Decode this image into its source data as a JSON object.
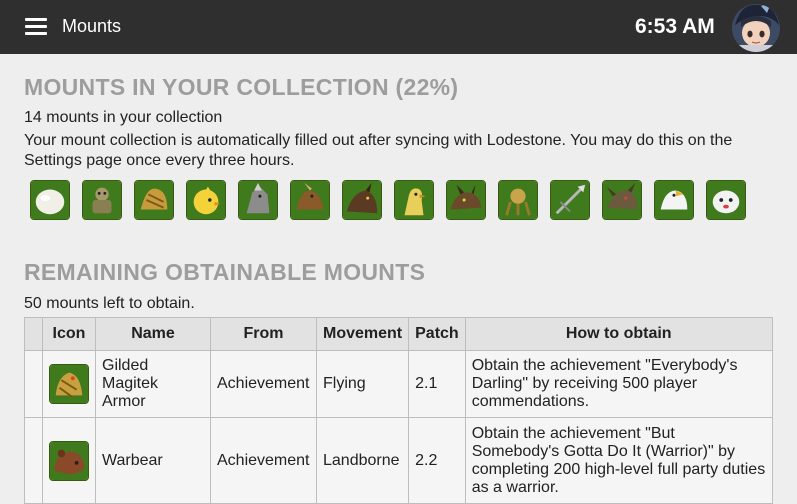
{
  "header": {
    "menu_icon": "hamburger-menu-icon",
    "title": "Mounts",
    "time": "6:53 AM",
    "avatar_icon": "character-avatar"
  },
  "collection": {
    "heading": "MOUNTS IN YOUR COLLECTION (22%)",
    "count_text": "14 mounts in your collection",
    "note_line1": "Your mount collection is automatically filled out after syncing with Lodestone. You may do this on the",
    "note_line2": "Settings page once every three hours.",
    "progress_percent": 22,
    "owned_icons": [
      "white-egg-mount-icon",
      "goblin-mech-mount-icon",
      "gold-bird-mount-icon",
      "yellow-chocobo-mount-icon",
      "grey-beast-mount-icon",
      "griffin-mount-icon",
      "dark-beast-mount-icon",
      "chocobo-mount-icon",
      "drake-mount-icon",
      "magitek-mount-icon",
      "spear-mount-icon",
      "dragon-mount-icon",
      "white-bird-mount-icon",
      "white-creature-mount-icon"
    ]
  },
  "remaining": {
    "heading": "REMAINING OBTAINABLE MOUNTS",
    "count_text": "50 mounts left to obtain.",
    "columns": [
      "",
      "Icon",
      "Name",
      "From",
      "Movement",
      "Patch",
      "How to obtain"
    ],
    "rows": [
      {
        "icon": "gilded-magitek-armor-icon",
        "name_lines": [
          "Gilded",
          "Magitek",
          "Armor"
        ],
        "from": "Achievement",
        "movement": "Flying",
        "patch": "2.1",
        "how_lines": [
          "Obtain the achievement \"Everybody's",
          "Darling\" by receiving 500 player",
          "commendations."
        ]
      },
      {
        "icon": "warbear-icon",
        "name_lines": [
          "Warbear"
        ],
        "from": "Achievement",
        "movement": "Landborne",
        "patch": "2.2",
        "how_lines": [
          "Obtain the achievement \"But",
          "Somebody's Gotta Do It (Warrior)\" by",
          "completing 200 high-level full party duties",
          "as a warrior."
        ]
      }
    ]
  },
  "colors": {
    "topbar": "#2f2f2f",
    "background": "#eeeeee",
    "heading": "#9d9d9d",
    "icon_bg": "#3f7a1c"
  }
}
